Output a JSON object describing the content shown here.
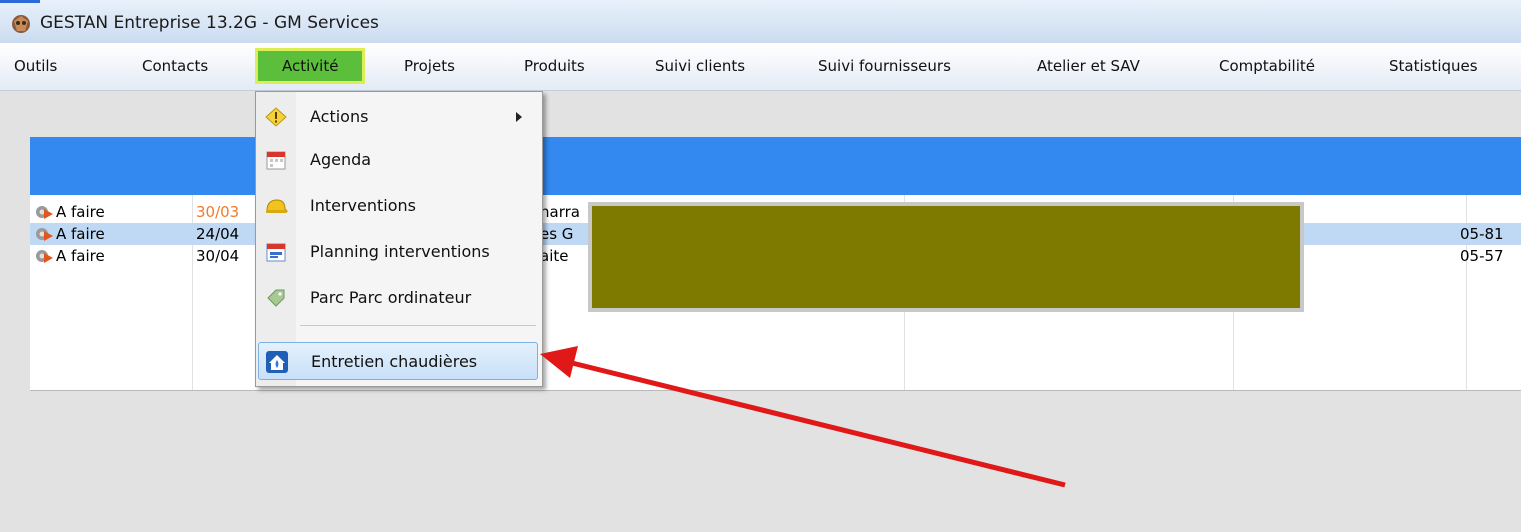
{
  "window": {
    "title": "GESTAN Entreprise 13.2G - GM Services"
  },
  "menubar": {
    "items": [
      {
        "label": "Outils"
      },
      {
        "label": "Contacts"
      },
      {
        "label": "Activité"
      },
      {
        "label": "Projets"
      },
      {
        "label": "Produits"
      },
      {
        "label": "Suivi clients"
      },
      {
        "label": "Suivi fournisseurs"
      },
      {
        "label": "Atelier et SAV"
      },
      {
        "label": "Comptabilité"
      },
      {
        "label": "Statistiques"
      }
    ],
    "active": "Activité"
  },
  "dropdown": {
    "items": [
      {
        "label": "Actions",
        "icon": "warning-diamond-icon",
        "has_submenu": true
      },
      {
        "label": "Agenda",
        "icon": "calendar-icon"
      },
      {
        "label": "Interventions",
        "icon": "hard-hat-icon"
      },
      {
        "label": "Planning interventions",
        "icon": "planning-calendar-icon"
      },
      {
        "label": "Parc Parc ordinateur",
        "icon": "tag-icon"
      },
      {
        "label": "Entretien chaudières",
        "icon": "boiler-house-icon",
        "highlighted": true
      }
    ]
  },
  "table": {
    "rows": [
      {
        "status": "A faire",
        "date": "30/03",
        "col3": "narra",
        "phone": "",
        "date_overdue": true
      },
      {
        "status": "A faire",
        "date": "24/04",
        "col3": "es G",
        "phone": "05-81",
        "selected": true
      },
      {
        "status": "A faire",
        "date": "30/04",
        "col3": "aite",
        "phone": "05-57"
      }
    ]
  },
  "colors": {
    "header_band": "#3389f0",
    "selected_row": "#bfd9f5",
    "redaction": "#7e7a00",
    "overdue_date": "#f07a2a",
    "annotation_arrow": "#e01818"
  }
}
